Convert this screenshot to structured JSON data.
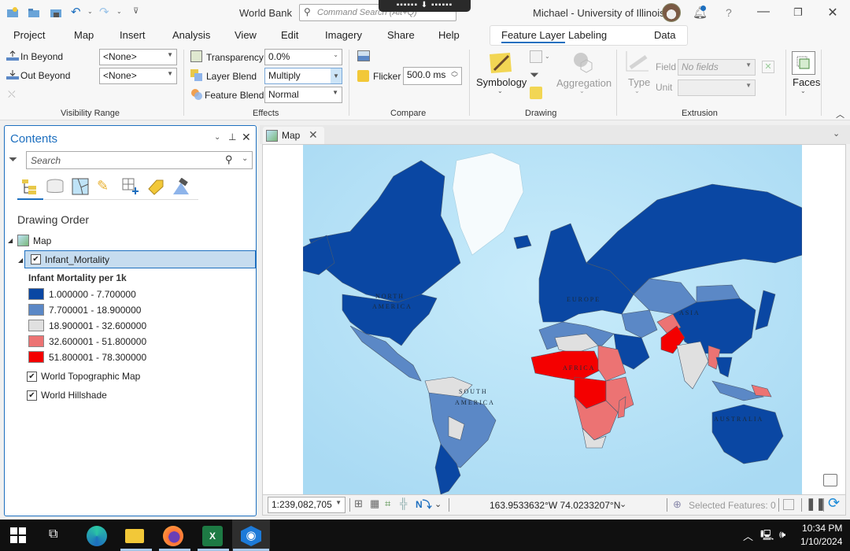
{
  "titlebar": {
    "app_title": "World Bank",
    "command_search_placeholder": "Command Search (Alt+Q)",
    "user": "Michael - University of Illinois",
    "help": "?",
    "quick_access": [
      "new-project-icon",
      "open-project-icon",
      "save-project-icon",
      "undo-icon",
      "redo-icon",
      "customize-icon"
    ]
  },
  "ribbon_tabs": [
    "Project",
    "Map",
    "Insert",
    "Analysis",
    "View",
    "Edit",
    "Imagery",
    "Share",
    "Help"
  ],
  "context_tabs": [
    "Feature Layer",
    "Labeling",
    "Data"
  ],
  "active_tab": "Feature Layer",
  "ribbon": {
    "visibility_range": {
      "label": "Visibility Range",
      "in_beyond": "In Beyond",
      "out_beyond": "Out Beyond",
      "in_beyond_value": "<None>",
      "out_beyond_value": "<None>"
    },
    "effects": {
      "label": "Effects",
      "transparency": "Transparency",
      "transparency_value": "0.0%",
      "layer_blend": "Layer Blend",
      "layer_blend_value": "Multiply",
      "feature_blend": "Feature Blend",
      "feature_blend_value": "Normal"
    },
    "compare": {
      "label": "Compare",
      "flicker": "Flicker",
      "flicker_value": "500.0  ms"
    },
    "drawing": {
      "label": "Drawing",
      "symbology": "Symbology",
      "aggregation": "Aggregation"
    },
    "extrusion": {
      "label": "Extrusion",
      "type": "Type",
      "field": "Field",
      "field_value": "No fields",
      "unit": "Unit",
      "unit_value": ""
    },
    "faces": {
      "label": "Faces"
    }
  },
  "contents": {
    "title": "Contents",
    "search_placeholder": "Search",
    "section": "Drawing Order",
    "map_name": "Map",
    "layers": [
      {
        "name": "Infant_Mortality",
        "checked": true,
        "selected": true
      },
      {
        "name": "World Topographic Map",
        "checked": true
      },
      {
        "name": "World Hillshade",
        "checked": true
      }
    ],
    "legend_title": "Infant Mortality per 1k",
    "legend": [
      {
        "label": "1.000000 - 7.700000",
        "color": "#0a47a3"
      },
      {
        "label": "7.700001 - 18.900000",
        "color": "#5b88c6"
      },
      {
        "label": "18.900001 - 32.600000",
        "color": "#e0e0e0"
      },
      {
        "label": "32.600001 - 51.800000",
        "color": "#ec7373"
      },
      {
        "label": "51.800001 - 78.300000",
        "color": "#f40000"
      }
    ]
  },
  "map_view": {
    "tab_label": "Map",
    "labels": [
      "NORTH",
      "AMERICA",
      "SOUTH",
      "AMERICA",
      "EUROPE",
      "AFRICA",
      "ASIA",
      "AUSTRALIA"
    ]
  },
  "statusbar": {
    "scale": "1:239,082,705",
    "coordinates": "163.9533632°W 74.0233207°N",
    "selected_features": "Selected Features: 0"
  },
  "taskbar": {
    "time": "10:34 PM",
    "date": "1/10/2024"
  }
}
